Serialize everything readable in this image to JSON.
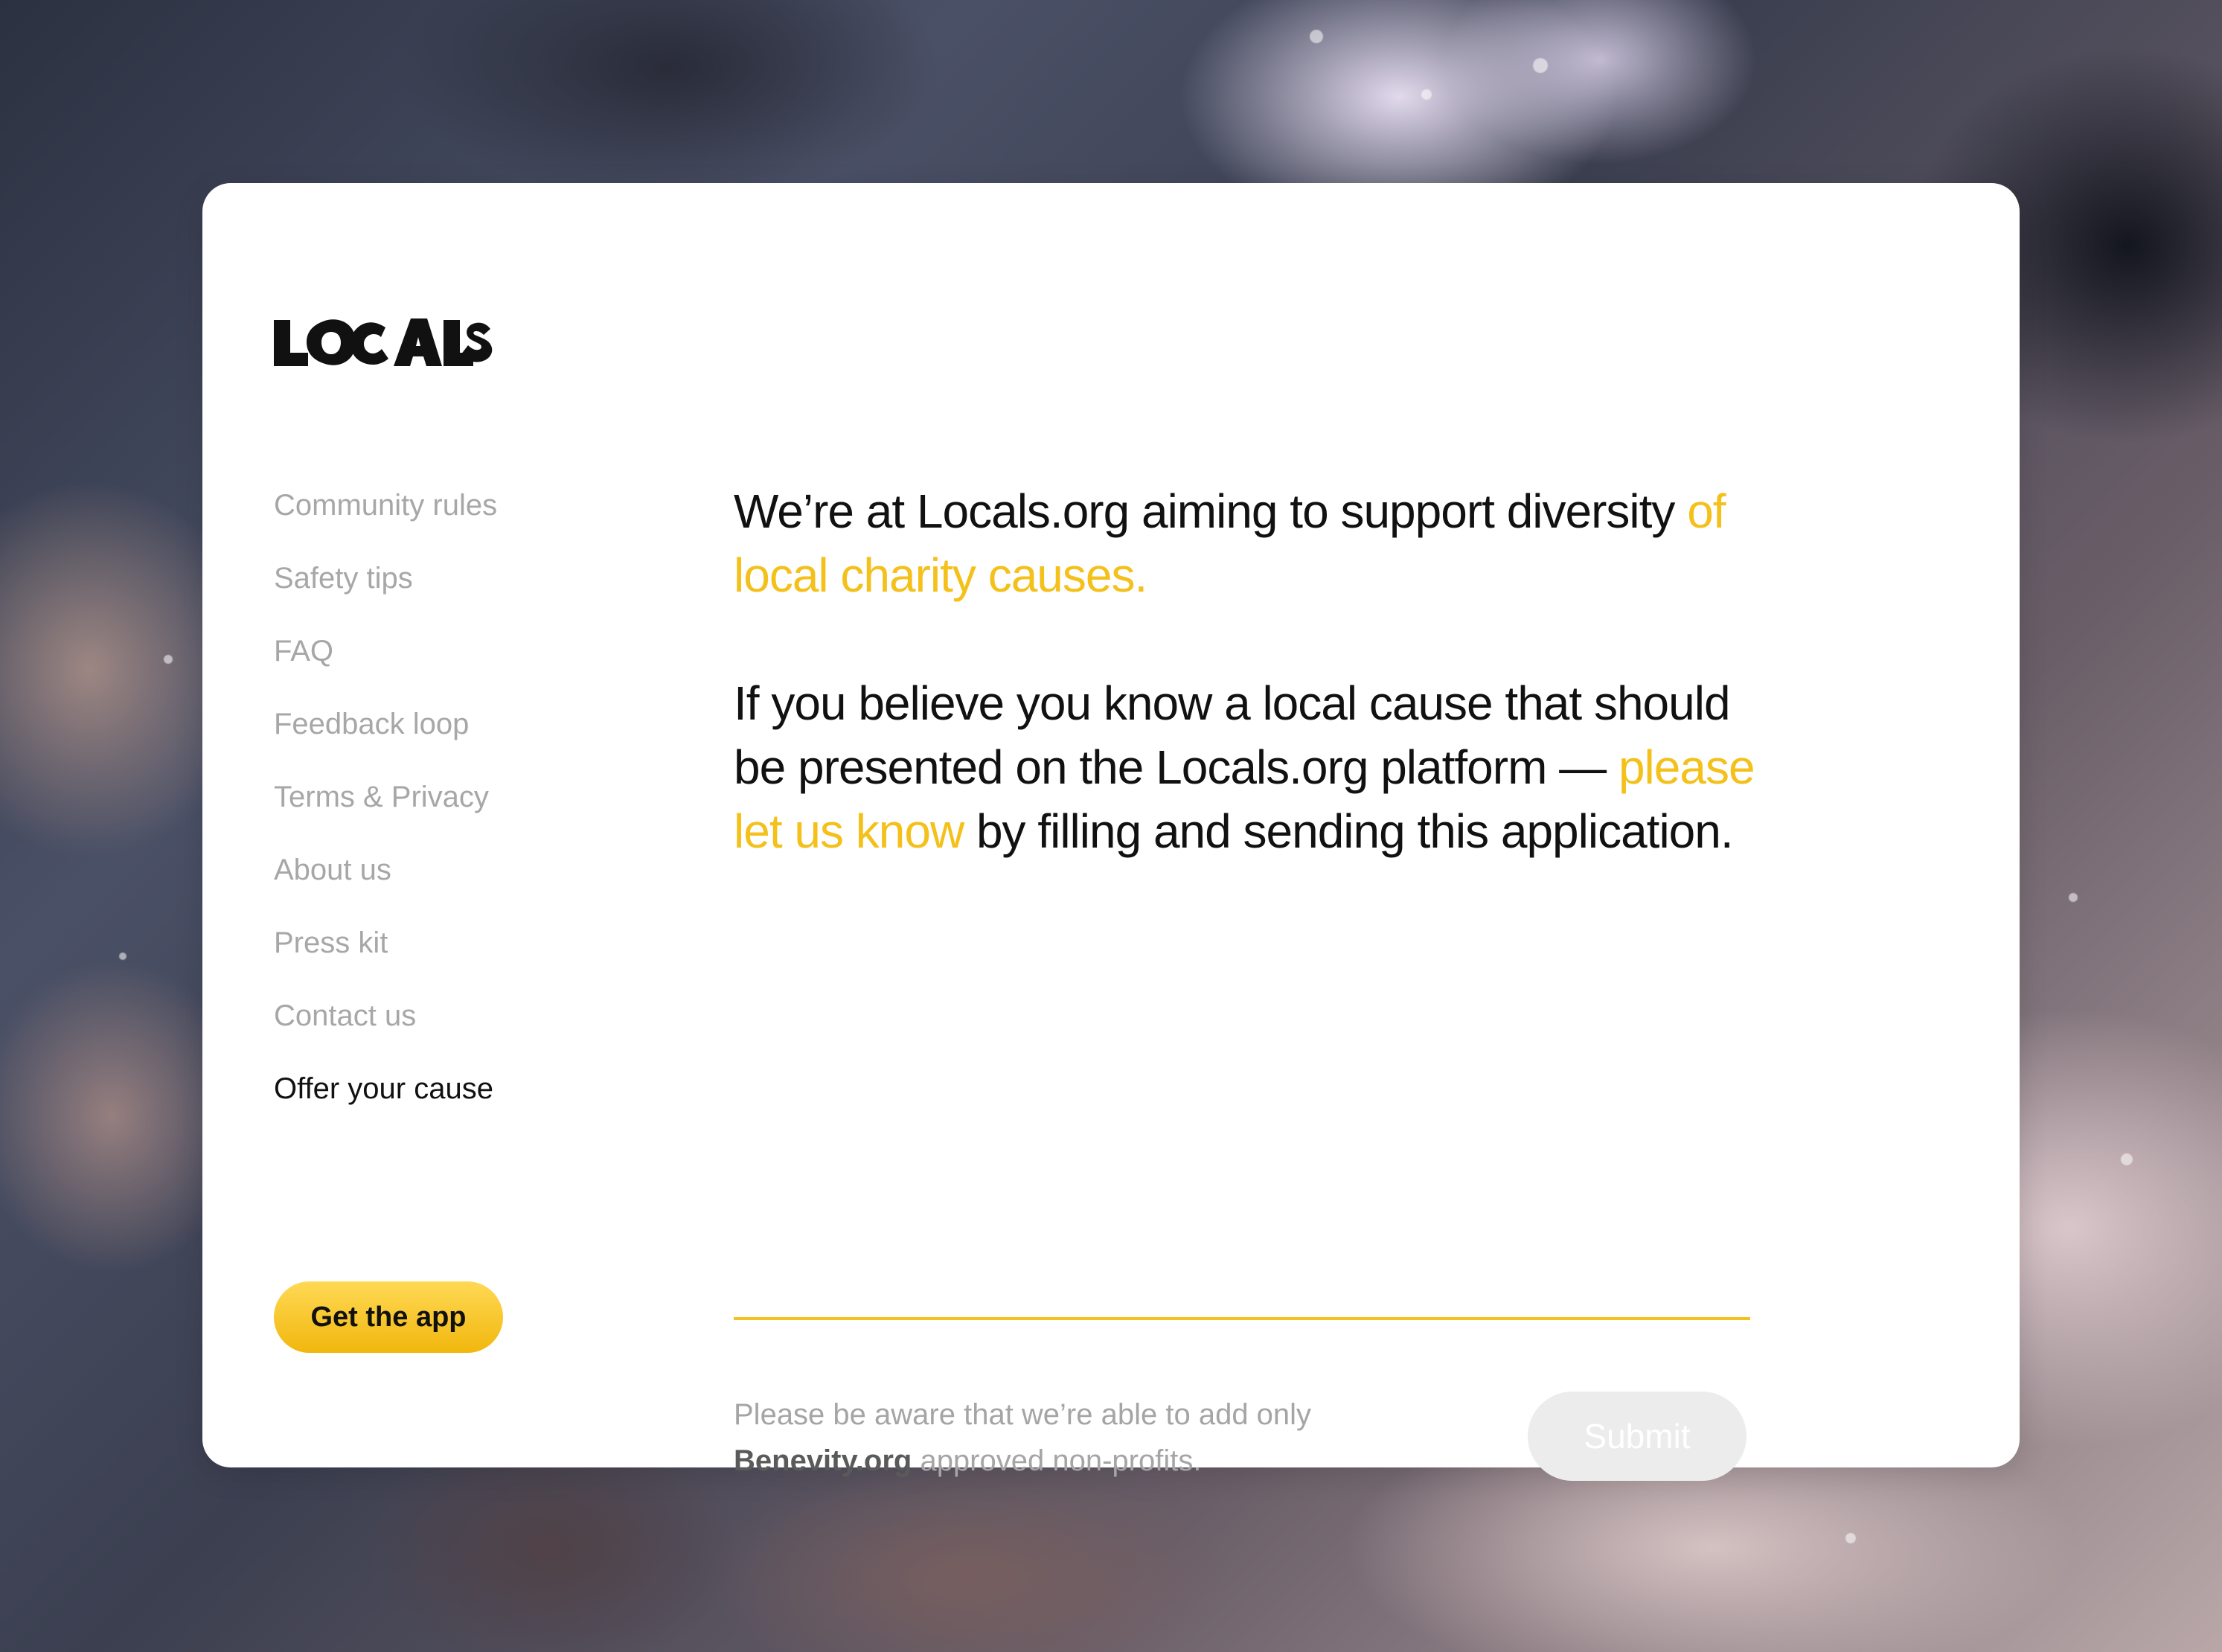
{
  "brand": {
    "logo_text": "LOCALS"
  },
  "nav": {
    "items": [
      {
        "label": "Community rules"
      },
      {
        "label": "Safety tips"
      },
      {
        "label": "FAQ"
      },
      {
        "label": "Feedback loop"
      },
      {
        "label": "Terms & Privacy"
      },
      {
        "label": "About us"
      },
      {
        "label": "Press kit"
      },
      {
        "label": "Contact us"
      },
      {
        "label": "Offer your cause",
        "active": true
      }
    ]
  },
  "cta": {
    "get_app_label": "Get the app"
  },
  "intro": {
    "p1_prefix": "We’re at Locals.org aiming to support diversity ",
    "p1_accent": "of local charity causes.",
    "p2_prefix": "If you believe you know a local cause that should be presented on the Locals.org platform — ",
    "p2_accent": "please let us know",
    "p2_suffix": " by filling and sending this application."
  },
  "form": {
    "cause_value": "",
    "cause_placeholder": "",
    "note_prefix": "Please be aware that we’re able to add only ",
    "note_brand": "Benevity.org",
    "note_suffix": " approved non-profits.",
    "submit_label": "Submit"
  },
  "colors": {
    "accent": "#f4c01a",
    "nav_inactive": "#a7a7a7",
    "nav_active": "#111111",
    "submit_disabled_bg": "#ececec"
  }
}
